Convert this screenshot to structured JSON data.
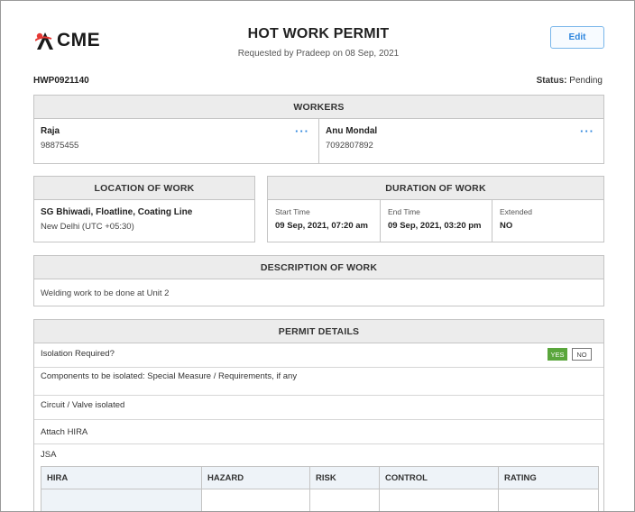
{
  "header": {
    "logo_text": "CME",
    "title": "HOT WORK PERMIT",
    "subtitle": "Requested by Pradeep on 08 Sep, 2021",
    "edit_label": "Edit",
    "brand_color": "#e53935"
  },
  "meta": {
    "permit_id": "HWP0921140",
    "status_label": "Status:",
    "status_value": "Pending"
  },
  "workers": {
    "heading": "WORKERS",
    "items": [
      {
        "name": "Raja",
        "phone": "98875455",
        "menu_icon": "more-dots-icon"
      },
      {
        "name": "Anu Mondal",
        "phone": "7092807892",
        "menu_icon": "more-dots-icon"
      }
    ],
    "menu_glyph": "···"
  },
  "location": {
    "heading": "LOCATION OF WORK",
    "place": "SG Bhiwadi, Floatline, Coating Line",
    "timezone": "New Delhi (UTC +05:30)"
  },
  "duration": {
    "heading": "DURATION OF WORK",
    "start_label": "Start Time",
    "start_value": "09 Sep, 2021, 07:20 am",
    "end_label": "End Time",
    "end_value": "09 Sep, 2021, 03:20 pm",
    "extended_label": "Extended",
    "extended_value": "NO"
  },
  "description": {
    "heading": "DESCRIPTION OF WORK",
    "text": "Welding work to be done at Unit 2"
  },
  "permit_details": {
    "heading": "PERMIT DETAILS",
    "isolation_question": "Isolation Required?",
    "yes_label": "YES",
    "no_label": "NO",
    "selected": "YES",
    "components_label": "Components to be isolated: Special Measure / Requirements, if any",
    "circuit_label": "Circuit / Valve isolated",
    "attach_label": "Attach HIRA",
    "jsa_label": "JSA",
    "table_headers": [
      "HIRA",
      "HAZARD",
      "RISK",
      "CONTROL",
      "RATING"
    ],
    "yes_color": "#5aa63c"
  }
}
